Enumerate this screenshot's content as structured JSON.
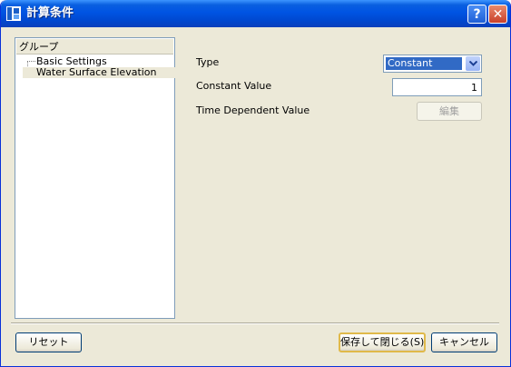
{
  "window": {
    "title": "計算条件"
  },
  "titlebar": {
    "help_glyph": "?",
    "close_glyph": "✕"
  },
  "tree": {
    "header": "グループ",
    "items": [
      {
        "label": "Basic Settings",
        "selected": false
      },
      {
        "label": "Water Surface Elevation",
        "selected": true
      }
    ]
  },
  "form": {
    "type_label": "Type",
    "type_value": "Constant",
    "constant_label": "Constant Value",
    "constant_value": "1",
    "time_label": "Time Dependent Value",
    "edit_button": "編集"
  },
  "footer": {
    "reset_button": "リセット",
    "save_close_button": "保存して閉じる(S)",
    "cancel_button": "キャンセル"
  },
  "colors": {
    "titlebar": "#0054e3",
    "selection": "#316ac5",
    "dialog_bg": "#ece9d8"
  }
}
